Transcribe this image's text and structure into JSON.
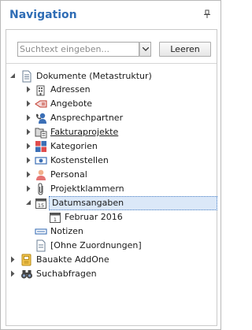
{
  "header": {
    "title": "Navigation"
  },
  "search": {
    "placeholder": "Suchtext eingeben...",
    "clear_label": "Leeren"
  },
  "tree": {
    "root": {
      "label": "Dokumente (Metastruktur)",
      "icon": "documents-icon"
    },
    "children": [
      {
        "label": "Adressen",
        "icon": "addresses-icon"
      },
      {
        "label": "Angebote",
        "icon": "offers-icon"
      },
      {
        "label": "Ansprechpartner",
        "icon": "contact-person-icon"
      },
      {
        "label": "Fakturaprojekte",
        "icon": "billing-projects-icon"
      },
      {
        "label": "Kategorien",
        "icon": "categories-icon"
      },
      {
        "label": "Kostenstellen",
        "icon": "cost-centers-icon"
      },
      {
        "label": "Personal",
        "icon": "personnel-icon"
      },
      {
        "label": "Projektklammern",
        "icon": "paperclip-icon"
      },
      {
        "label": "Datumsangaben",
        "icon": "calendar-icon",
        "expanded": true,
        "selected": true,
        "children": [
          {
            "label": "Februar 2016",
            "icon": "calendar-icon"
          }
        ]
      },
      {
        "label": "Notizen",
        "icon": "notes-icon"
      },
      {
        "label": "[Ohne Zuordnungen]",
        "icon": "document-icon"
      }
    ],
    "others": [
      {
        "label": "Bauakte AddOne",
        "icon": "construction-file-icon"
      },
      {
        "label": "Suchabfragen",
        "icon": "binoculars-icon"
      }
    ]
  },
  "colors": {
    "title": "#2f6db5",
    "selection": "#dbe8f8",
    "selection_border": "#4a7fc4"
  }
}
